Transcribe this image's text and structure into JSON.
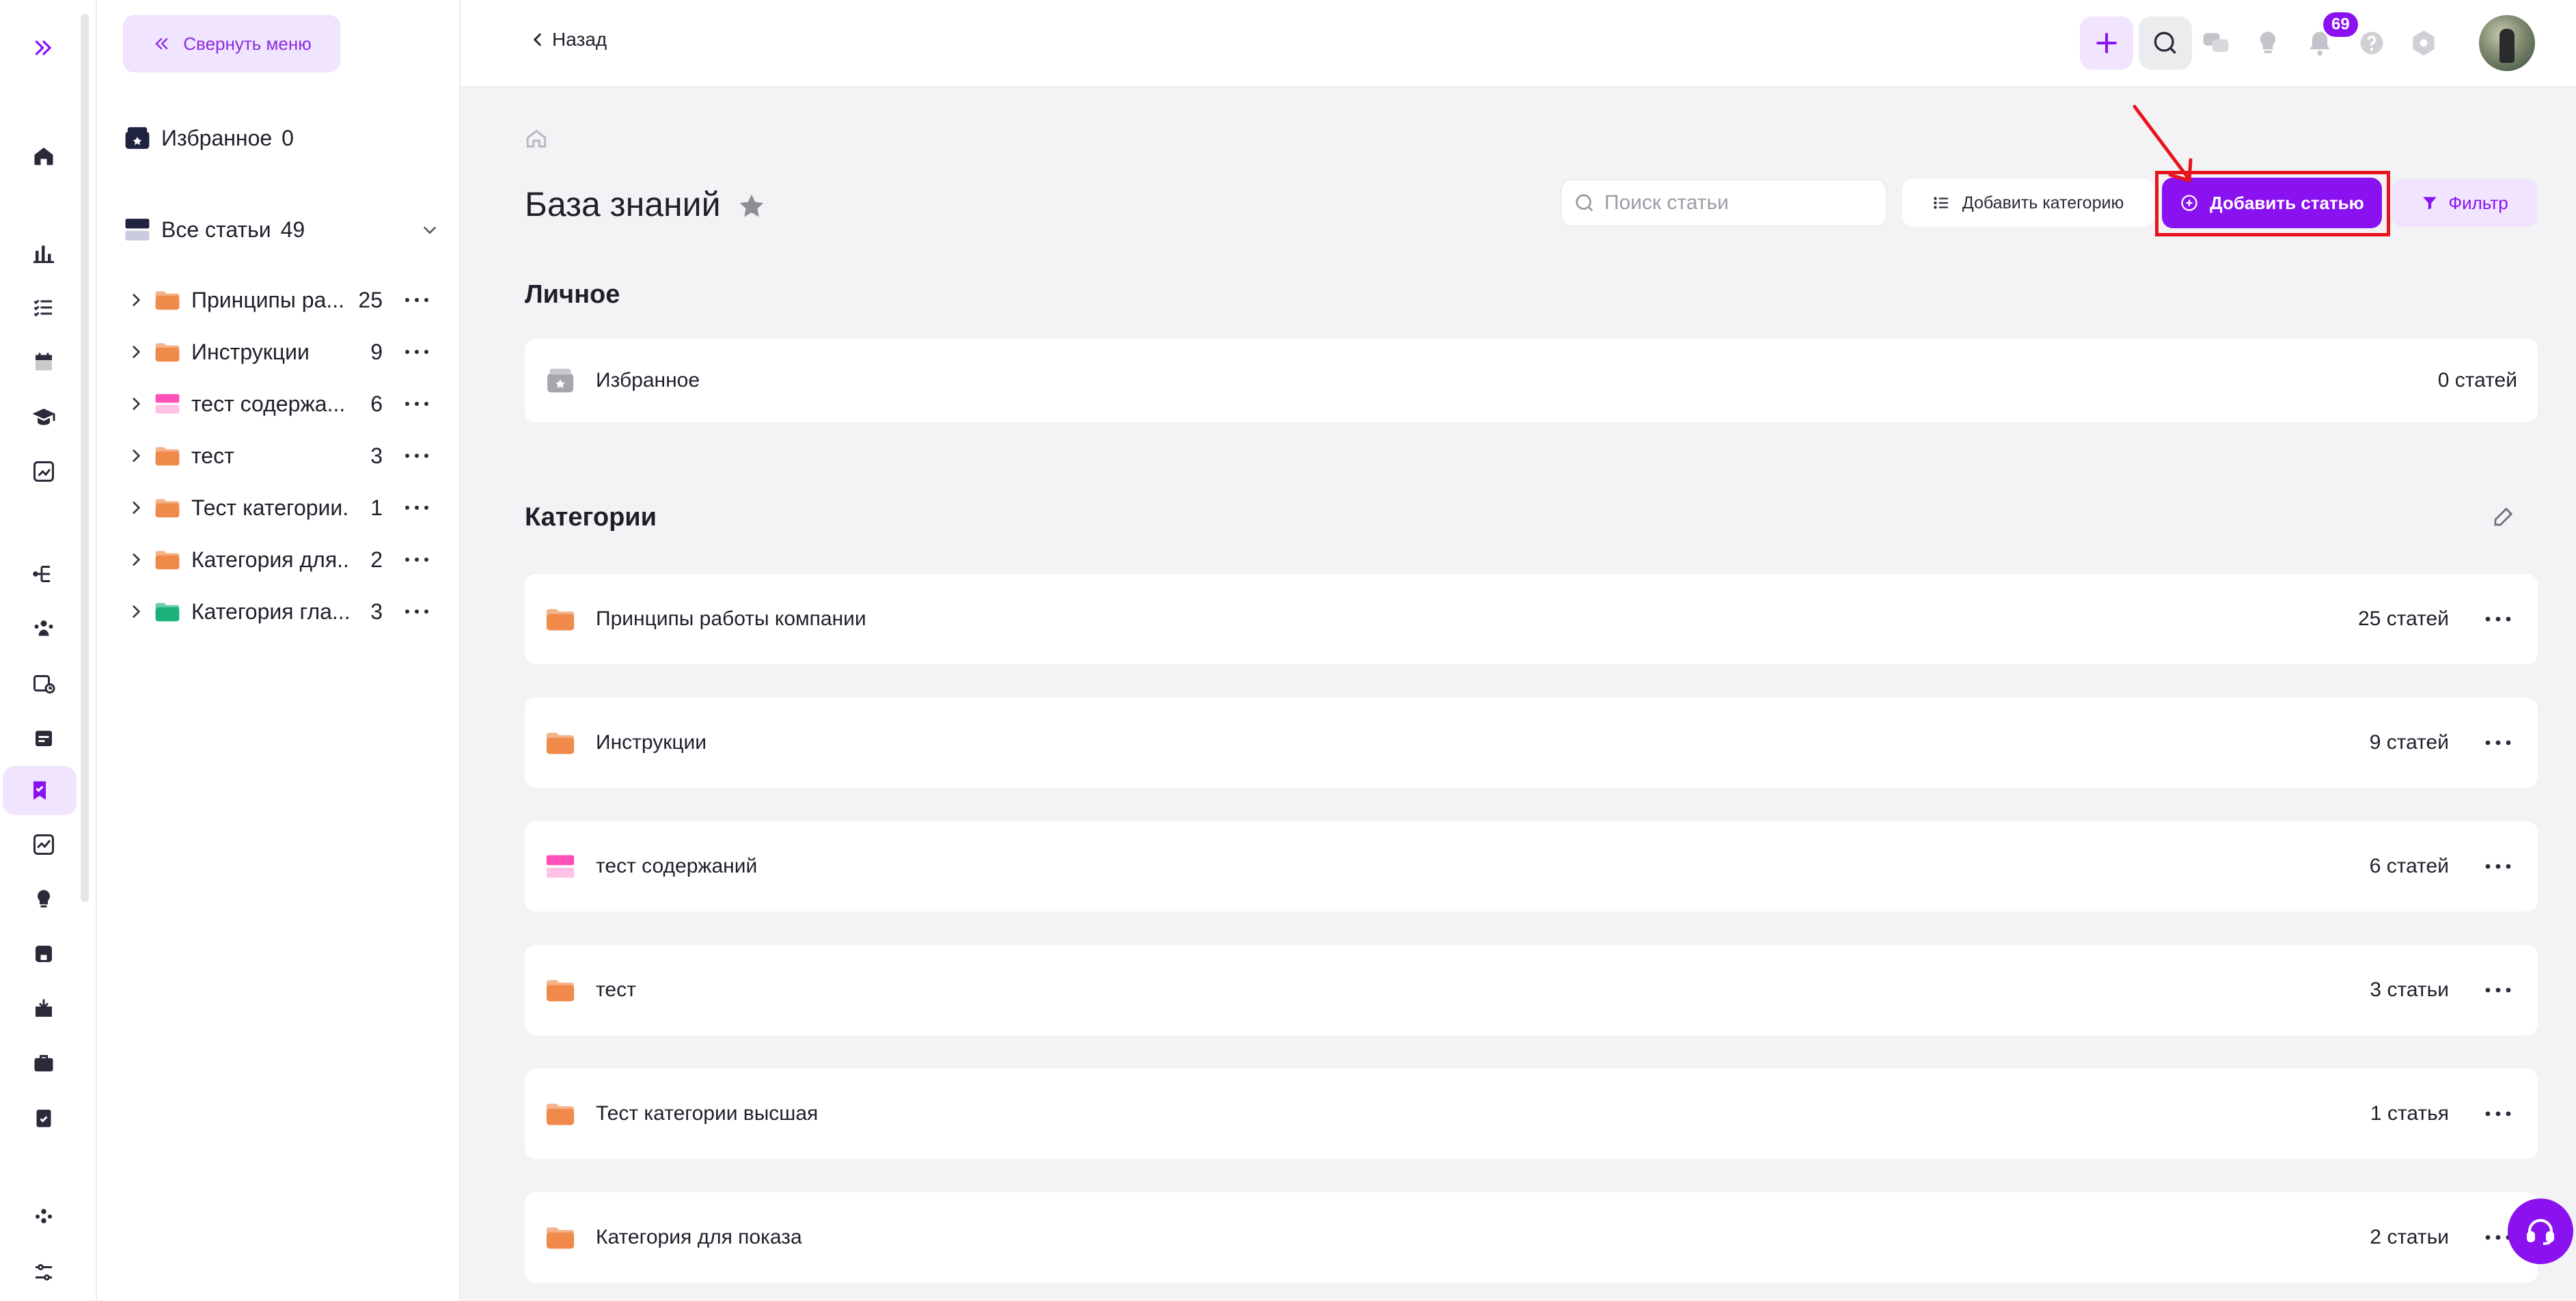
{
  "sidebar": {
    "collapse_label": "Свернуть меню",
    "favorites": {
      "label": "Избранное",
      "count": "0"
    },
    "all_articles": {
      "label": "Все статьи",
      "count": "49"
    },
    "categories": [
      {
        "name": "Принципы ра...",
        "count": "25",
        "color": "#f08a4b"
      },
      {
        "name": "Инструкции",
        "count": "9",
        "color": "#f08a4b"
      },
      {
        "name": "тест содержа...",
        "count": "6",
        "color": "#ff4fb8"
      },
      {
        "name": "тест",
        "count": "3",
        "color": "#f08a4b"
      },
      {
        "name": "Тест категории...",
        "count": "1",
        "color": "#f08a4b"
      },
      {
        "name": "Категория для...",
        "count": "2",
        "color": "#f08a4b"
      },
      {
        "name": "Категория гла...",
        "count": "3",
        "color": "#1bb27a"
      }
    ]
  },
  "topbar": {
    "back_label": "Назад",
    "notifications_count": "69"
  },
  "main": {
    "title": "База знаний",
    "search_placeholder": "Поиск статьи",
    "add_category_label": "Добавить категорию",
    "add_article_label": "Добавить статью",
    "filter_label": "Фильтр",
    "personal_section": "Личное",
    "favorites_card": {
      "name": "Избранное",
      "count": "0 статей"
    },
    "categories_section": "Категории",
    "category_cards": [
      {
        "name": "Принципы работы компании",
        "count": "25 статей",
        "color": "#f08a4b"
      },
      {
        "name": "Инструкции",
        "count": "9 статей",
        "color": "#f08a4b"
      },
      {
        "name": "тест содержаний",
        "count": "6 статей",
        "color": "#ff4fb8"
      },
      {
        "name": "тест",
        "count": "3 статьи",
        "color": "#f08a4b"
      },
      {
        "name": "Тест категории высшая",
        "count": "1 статья",
        "color": "#f08a4b"
      },
      {
        "name": "Категория для показа",
        "count": "2 статьи",
        "color": "#f08a4b"
      }
    ]
  },
  "colors": {
    "accent": "#8a12f0",
    "accent_light": "#f1e4ff",
    "highlight": "#e8141d"
  }
}
